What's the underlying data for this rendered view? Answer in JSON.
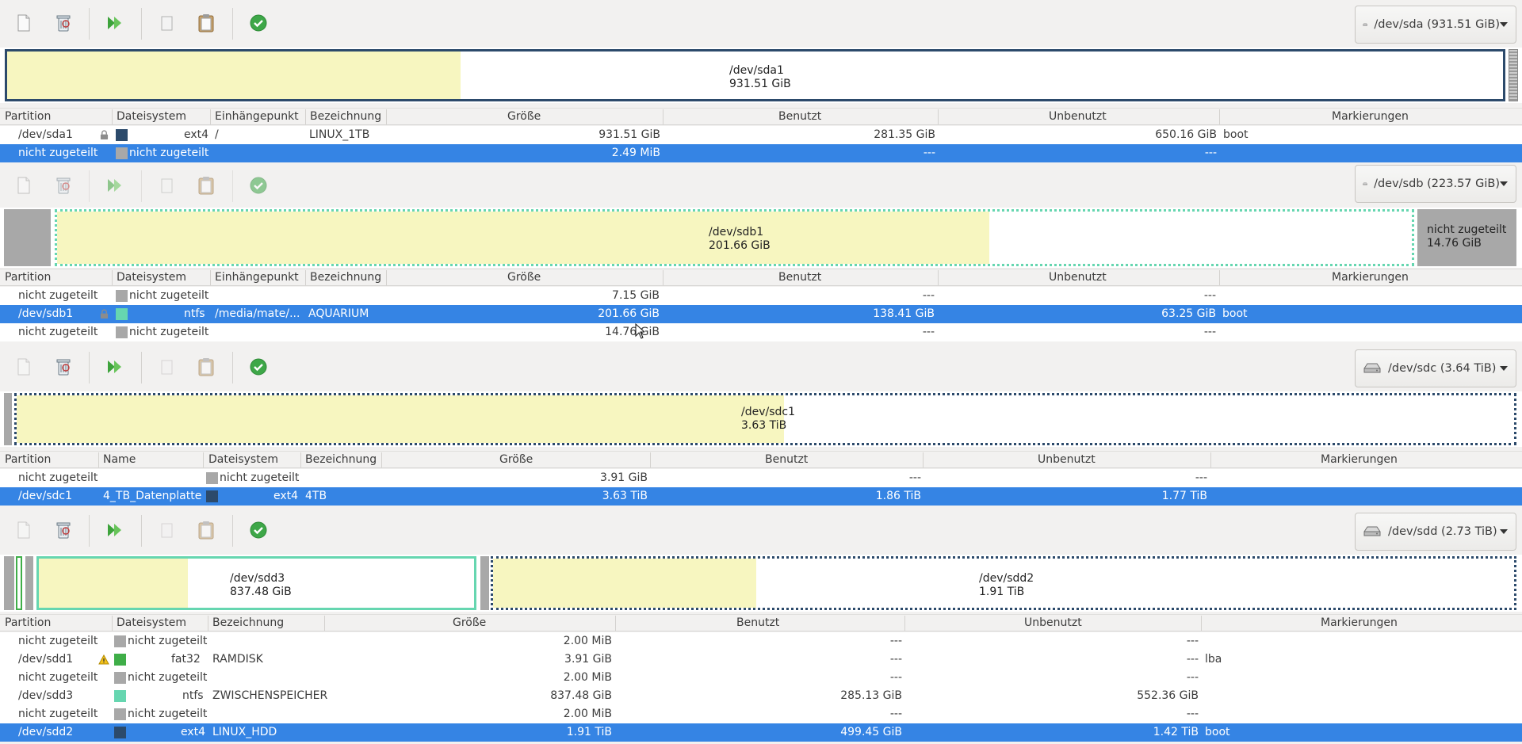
{
  "colors": {
    "used": "#f7f6c0",
    "unallocated": "#a8a8a8",
    "ext4": "#2c4a6b",
    "ntfs": "#66d6b0",
    "fat32": "#3fae48",
    "selection": "#3584e4",
    "frame_blue": "#2c4a6b"
  },
  "toolbar_icons": [
    "new-icon",
    "delete-icon",
    "apply-icon",
    "copy-icon",
    "paste-icon",
    "check-icon"
  ],
  "panes": [
    {
      "device": "/dev/sda (931.51 GiB)",
      "map": {
        "partitions": [
          {
            "name": "/dev/sda1",
            "size": "931.51 GiB",
            "used_fraction": 0.3
          }
        ]
      },
      "columns": [
        "Partition",
        "Dateisystem",
        "Einhängepunkt",
        "Bezeichnung",
        "Größe",
        "Benutzt",
        "Unbenutzt",
        "Markierungen"
      ],
      "rows": [
        {
          "partition": "/dev/sda1",
          "locked": true,
          "fs": "ext4",
          "mount": "/",
          "label": "LINUX_1TB",
          "size": "931.51 GiB",
          "used": "281.35 GiB",
          "unused": "650.16 GiB",
          "flags": "boot",
          "selected": false
        },
        {
          "partition": "nicht zugeteilt",
          "fs": "nicht zugeteilt",
          "mount": "",
          "label": "",
          "size": "2.49 MiB",
          "used": "---",
          "unused": "---",
          "flags": "",
          "selected": true
        }
      ]
    },
    {
      "device": "/dev/sdb (223.57 GiB)",
      "map": {
        "partitions": [
          {
            "name": "/dev/sdb1",
            "size": "201.66 GiB",
            "used_fraction": 0.686
          },
          {
            "name": "nicht zugeteilt",
            "size": "14.76 GiB"
          }
        ]
      },
      "columns": [
        "Partition",
        "Dateisystem",
        "Einhängepunkt",
        "Bezeichnung",
        "Größe",
        "Benutzt",
        "Unbenutzt",
        "Markierungen"
      ],
      "rows": [
        {
          "partition": "nicht zugeteilt",
          "fs": "nicht zugeteilt",
          "mount": "",
          "label": "",
          "size": "7.15 GiB",
          "used": "---",
          "unused": "---",
          "flags": "",
          "selected": false
        },
        {
          "partition": "/dev/sdb1",
          "locked": true,
          "fs": "ntfs",
          "mount": "/media/mate/...",
          "label": "AQUARIUM",
          "size": "201.66 GiB",
          "used": "138.41 GiB",
          "unused": "63.25 GiB",
          "flags": "boot",
          "selected": true
        },
        {
          "partition": "nicht zugeteilt",
          "fs": "nicht zugeteilt",
          "mount": "",
          "label": "",
          "size": "14.76 GiB",
          "used": "---",
          "unused": "---",
          "flags": "",
          "selected": false
        }
      ]
    },
    {
      "device": "/dev/sdc (3.64 TiB)",
      "map": {
        "partitions": [
          {
            "name": "/dev/sdc1",
            "size": "3.63 TiB",
            "used_fraction": 0.511
          }
        ]
      },
      "columns": [
        "Partition",
        "Name",
        "Dateisystem",
        "Bezeichnung",
        "Größe",
        "Benutzt",
        "Unbenutzt",
        "Markierungen"
      ],
      "rows": [
        {
          "partition": "nicht zugeteilt",
          "name": "",
          "fs": "nicht zugeteilt",
          "label": "",
          "size": "3.91 GiB",
          "used": "---",
          "unused": "---",
          "flags": "",
          "selected": false
        },
        {
          "partition": "/dev/sdc1",
          "name": "4_TB_Datenplatte",
          "fs": "ext4",
          "label": "4TB",
          "size": "3.63 TiB",
          "used": "1.86 TiB",
          "unused": "1.77 TiB",
          "flags": "",
          "selected": true
        }
      ]
    },
    {
      "device": "/dev/sdd (2.73 TiB)",
      "map": {
        "partitions": [
          {
            "name": "/dev/sdd3",
            "size": "837.48 GiB",
            "used_fraction": 0.34
          },
          {
            "name": "/dev/sdd2",
            "size": "1.91 TiB",
            "used_fraction": 0.257
          }
        ]
      },
      "columns": [
        "Partition",
        "Dateisystem",
        "Bezeichnung",
        "Größe",
        "Benutzt",
        "Unbenutzt",
        "Markierungen"
      ],
      "rows": [
        {
          "partition": "nicht zugeteilt",
          "fs": "nicht zugeteilt",
          "label": "",
          "size": "2.00 MiB",
          "used": "---",
          "unused": "---",
          "flags": "",
          "selected": false
        },
        {
          "partition": "/dev/sdd1",
          "warning": true,
          "fs": "fat32",
          "label": "RAMDISK",
          "size": "3.91 GiB",
          "used": "---",
          "unused": "---",
          "flags": "lba",
          "selected": false
        },
        {
          "partition": "nicht zugeteilt",
          "fs": "nicht zugeteilt",
          "label": "",
          "size": "2.00 MiB",
          "used": "---",
          "unused": "---",
          "flags": "",
          "selected": false
        },
        {
          "partition": "/dev/sdd3",
          "fs": "ntfs",
          "label": "ZWISCHENSPEICHER",
          "size": "837.48 GiB",
          "used": "285.13 GiB",
          "unused": "552.36 GiB",
          "flags": "",
          "selected": false
        },
        {
          "partition": "nicht zugeteilt",
          "fs": "nicht zugeteilt",
          "label": "",
          "size": "2.00 MiB",
          "used": "---",
          "unused": "---",
          "flags": "",
          "selected": false
        },
        {
          "partition": "/dev/sdd2",
          "fs": "ext4",
          "label": "LINUX_HDD",
          "size": "1.91 TiB",
          "used": "499.45 GiB",
          "unused": "1.42 TiB",
          "flags": "boot",
          "selected": true
        }
      ]
    }
  ]
}
